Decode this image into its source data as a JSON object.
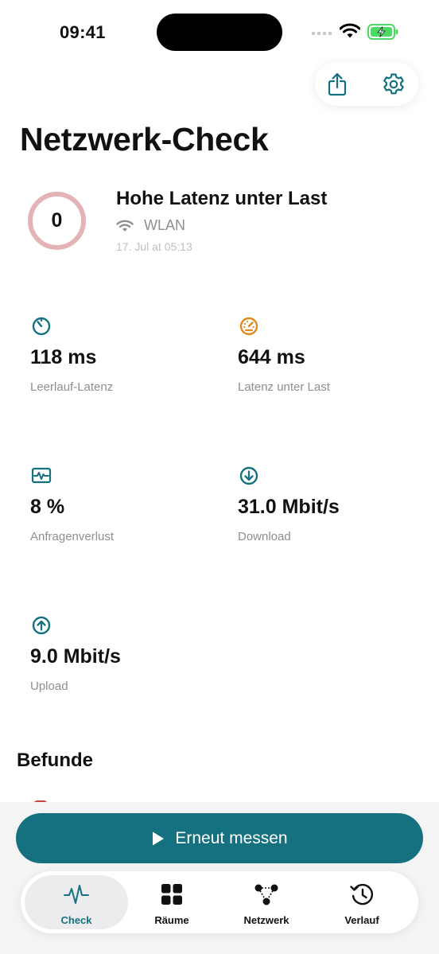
{
  "status_bar": {
    "time": "09:41"
  },
  "header": {
    "title": "Netzwerk-Check"
  },
  "summary": {
    "score": "0",
    "title": "Hohe Latenz unter Last",
    "network": "WLAN",
    "timestamp": "17. Jul at 05:13"
  },
  "metrics": [
    {
      "icon": "timer-icon",
      "value": "118 ms",
      "label": "Leerlauf-Latenz",
      "color": "#15717f"
    },
    {
      "icon": "speedometer-icon",
      "value": "644 ms",
      "label": "Latenz unter Last",
      "color": "#e08a1e"
    },
    {
      "icon": "activity-monitor-icon",
      "value": "8 %",
      "label": "Anfragenverlust",
      "color": "#15717f"
    },
    {
      "icon": "download-arrow-icon",
      "value": "31.0 Mbit/s",
      "label": "Download",
      "color": "#15717f"
    },
    {
      "icon": "upload-arrow-icon",
      "value": "9.0 Mbit/s",
      "label": "Upload",
      "color": "#15717f"
    }
  ],
  "findings": {
    "title": "Befunde"
  },
  "action": {
    "label": "Erneut messen"
  },
  "tabs": [
    {
      "label": "Check",
      "icon": "pulse-icon",
      "active": true
    },
    {
      "label": "Räume",
      "icon": "grid-icon",
      "active": false
    },
    {
      "label": "Netzwerk",
      "icon": "network-nodes-icon",
      "active": false
    },
    {
      "label": "Verlauf",
      "icon": "history-clock-icon",
      "active": false
    }
  ],
  "colors": {
    "accent": "#15717f",
    "warning": "#e08a1e",
    "score_ring": "#e4b3b5",
    "battery": "#4cd964"
  }
}
